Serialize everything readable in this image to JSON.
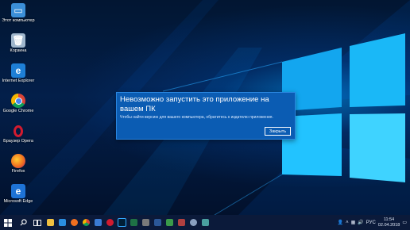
{
  "desktop_icons": [
    {
      "label": "Этот компьютер",
      "icon": "computer-icon",
      "color": "#3b8fd8"
    },
    {
      "label": "Корзина",
      "icon": "recycle-bin-icon",
      "color": "#9fb6cc"
    },
    {
      "label": "Internet Explorer",
      "icon": "internet-explorer-icon",
      "color": "#1e7fd6"
    },
    {
      "label": "Google Chrome",
      "icon": "chrome-icon",
      "color": "#e9b400"
    },
    {
      "label": "Браузер Opera",
      "icon": "opera-icon",
      "color": "#d21b2f"
    },
    {
      "label": "Firefox",
      "icon": "firefox-icon",
      "color": "#f07020"
    },
    {
      "label": "Microsoft Edge",
      "icon": "edge-icon",
      "color": "#1e73d6"
    }
  ],
  "dialog": {
    "title": "Невозможно запустить это приложение на вашем ПК",
    "message": "Чтобы найти версию для вашего компьютера, обратитесь к издателю приложения.",
    "close_label": "Закрыть"
  },
  "taskbar": {
    "apps": [
      {
        "icon": "file-explorer-icon",
        "color": "#f0c040"
      },
      {
        "icon": "internet-explorer-icon",
        "color": "#2a8ee0"
      },
      {
        "icon": "firefox-icon",
        "color": "#f07020"
      },
      {
        "icon": "chrome-icon",
        "color": "#e9b400"
      },
      {
        "icon": "store-icon",
        "color": "#3a7bd5"
      },
      {
        "icon": "opera-icon",
        "color": "#d21b2f"
      },
      {
        "icon": "photoshop-icon",
        "color": "#31a8ff"
      },
      {
        "icon": "excel-icon",
        "color": "#1e7145"
      },
      {
        "icon": "app-icon",
        "color": "#7a7a7a"
      },
      {
        "icon": "word-icon",
        "color": "#2b5797"
      },
      {
        "icon": "app-icon-2",
        "color": "#3a9a4a"
      },
      {
        "icon": "app-icon-3",
        "color": "#b04040"
      },
      {
        "icon": "settings-icon",
        "color": "#8aa0c0"
      },
      {
        "icon": "app-icon-4",
        "color": "#4aa0a0"
      }
    ],
    "tray": {
      "language": "РУС",
      "time": "11:54",
      "date": "02.04.2018"
    }
  }
}
